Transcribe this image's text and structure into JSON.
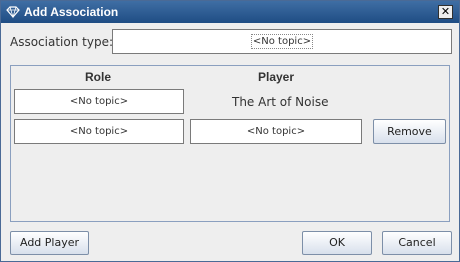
{
  "window": {
    "title": "Add Association",
    "close_glyph": "✕"
  },
  "association": {
    "label": "Association type:",
    "value": "<No topic>"
  },
  "table": {
    "headers": {
      "role": "Role",
      "player": "Player"
    },
    "rows": [
      {
        "role": "<No topic>",
        "player_text": "The Art of Noise"
      },
      {
        "role": "<No topic>",
        "player": "<No topic>",
        "remove_label": "Remove"
      }
    ]
  },
  "buttons": {
    "add_player": "Add Player",
    "ok": "OK",
    "cancel": "Cancel"
  },
  "icons": {
    "title": "app-diamond-icon",
    "close": "close-icon"
  },
  "colors": {
    "titlebar": "#2f5d94",
    "panel_border": "#8a9fbf",
    "background": "#eeeeee"
  }
}
